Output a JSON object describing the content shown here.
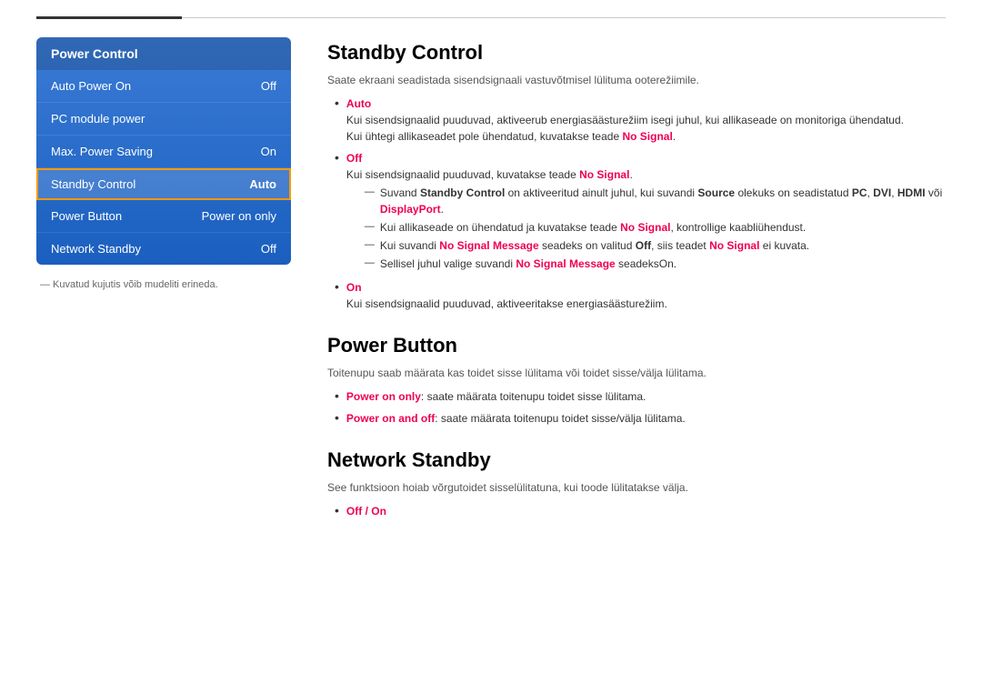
{
  "topbar": {},
  "leftPanel": {
    "title": "Power Control",
    "items": [
      {
        "label": "Auto Power On",
        "value": "Off",
        "active": false
      },
      {
        "label": "PC module power",
        "value": "",
        "active": false
      },
      {
        "label": "Max. Power Saving",
        "value": "On",
        "active": false
      },
      {
        "label": "Standby Control",
        "value": "Auto",
        "active": true
      },
      {
        "label": "Power Button",
        "value": "Power on only",
        "active": false
      },
      {
        "label": "Network Standby",
        "value": "Off",
        "active": false
      }
    ],
    "note": "— Kuvatud kujutis võib mudeliti erineda."
  },
  "content": {
    "sections": [
      {
        "id": "standby-control",
        "title": "Standby Control",
        "desc": "Saate ekraani seadistada sisendsignaali vastuvõtmisel lülituma ooterežiimile.",
        "bullets": [
          {
            "label": "Auto",
            "labelColor": "red",
            "text1": "Kui sisendsignaalid puuduvad, aktiveerub energiasäästurežiim isegi juhul, kui allikaseade on monitoriga ühendatud.",
            "text2": "Kui ühtegi allikaseadet pole ühendatud, kuvatakse teade ",
            "text2highlight": "No Signal",
            "text2rest": ".",
            "subBullets": []
          },
          {
            "label": "Off",
            "labelColor": "red",
            "text1": "Kui sisendsignaalid puuduvad, kuvatakse teade ",
            "text1highlight": "No Signal",
            "text1rest": ".",
            "subBullets": [
              {
                "text": "Suvand ",
                "highlight1": "Standby Control",
                "mid1": " on aktiveeritud ainult juhul, kui suvandi ",
                "highlight2": "Source",
                "mid2": " olekuks on seadistatud ",
                "highlight3": "PC",
                "sep1": ", ",
                "highlight4": "DVI",
                "sep2": ", ",
                "highlight5": "HDMI",
                "end": " või ",
                "highlight6": "DisplayPort",
                "end2": "."
              },
              {
                "text": "Kui allikaseade on ühendatud ja kuvatakse teade ",
                "highlight1": "No Signal",
                "mid1": ", kontrollige kaabliühendust."
              },
              {
                "text": "Kui suvandi ",
                "highlight1": "No Signal Message",
                "mid1": " seadeks on valitud ",
                "highlight2": "Off",
                "mid2": ", siis teadet ",
                "highlight3": "No Signal",
                "end": " ei kuvata."
              },
              {
                "text": "Sellisel juhul valige suvandi ",
                "highlight1": "No Signal Message",
                "end": " seadeksOn."
              }
            ]
          },
          {
            "label": "On",
            "labelColor": "red",
            "text1": "Kui sisendsignaalid puuduvad, aktiveeritakse energiasäästurežiim.",
            "subBullets": []
          }
        ]
      },
      {
        "id": "power-button",
        "title": "Power Button",
        "desc": "Toitenupu saab määrata kas toidet sisse lülitama või toidet sisse/välja lülitama.",
        "bullets": [
          {
            "label": "Power on only",
            "labelColor": "red",
            "text1": ": saate määrata toitenupu toidet sisse lülitama."
          },
          {
            "label": "Power on and off",
            "labelColor": "red",
            "text1": ": saate määrata toitenupu toidet sisse/välja lülitama."
          }
        ]
      },
      {
        "id": "network-standby",
        "title": "Network Standby",
        "desc": "See funktsioon hoiab võrgutoidet sisselülitatuna, kui toode lülitatakse välja.",
        "bullets": [
          {
            "label": "Off / On",
            "labelColor": "red",
            "text1": ""
          }
        ]
      }
    ]
  }
}
